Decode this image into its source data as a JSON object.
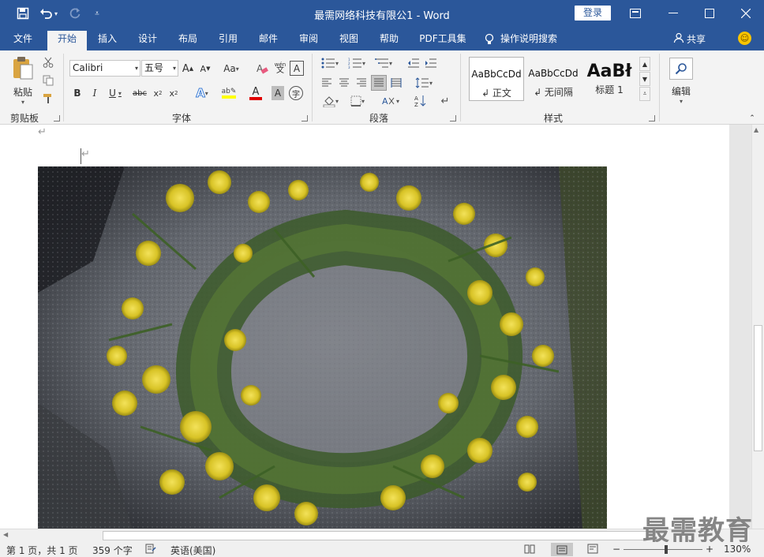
{
  "titlebar": {
    "title": "最需网络科技有限公1  -  Word",
    "login_label": "登录"
  },
  "tabs": [
    {
      "label": "文件"
    },
    {
      "label": "开始"
    },
    {
      "label": "插入"
    },
    {
      "label": "设计"
    },
    {
      "label": "布局"
    },
    {
      "label": "引用"
    },
    {
      "label": "邮件"
    },
    {
      "label": "审阅"
    },
    {
      "label": "视图"
    },
    {
      "label": "帮助"
    },
    {
      "label": "PDF工具集"
    },
    {
      "label": "操作说明搜索"
    }
  ],
  "share_label": "共享",
  "ribbon": {
    "clipboard": {
      "paste_label": "粘贴",
      "group_label": "剪贴板"
    },
    "font": {
      "font_name": "Calibri",
      "font_size": "五号",
      "aa_label": "Aa",
      "group_label": "字体",
      "pinyin_label": "wén"
    },
    "paragraph": {
      "group_label": "段落"
    },
    "styles": {
      "items": [
        {
          "sample": "AaBbCcDd",
          "name": "↲ 正文"
        },
        {
          "sample": "AaBbCcDd",
          "name": "↲ 无间隔"
        },
        {
          "sample": "AaBł",
          "name": "标题 1"
        }
      ],
      "group_label": "样式"
    },
    "editing": {
      "label": "编辑"
    }
  },
  "document": {
    "para_mark_1": "↵",
    "para_mark_2": "↵"
  },
  "statusbar": {
    "page": "第 1 页，共 1 页",
    "words": "359 个字",
    "language": "英语(美国)",
    "zoom": "130%"
  },
  "watermark": "最需教育",
  "colors": {
    "brand": "#2b579a",
    "ribbon_bg": "#f3f3f3"
  }
}
